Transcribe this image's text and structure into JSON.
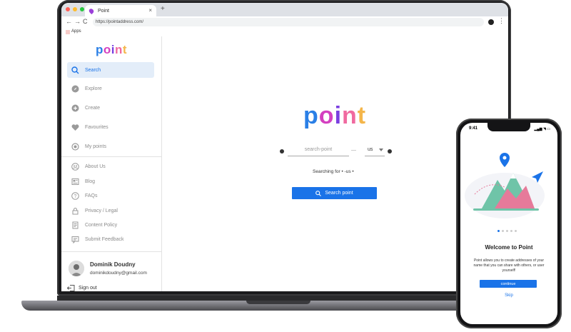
{
  "browser": {
    "tab_title": "Point",
    "tab_close": "×",
    "new_tab": "+",
    "back": "←",
    "forward": "→",
    "reload": "C",
    "url": "https://pointaddress.com/",
    "menu": "⋮",
    "bookmarks_label": "Apps",
    "window_dot_colors": [
      "#ff5f57",
      "#febc2e",
      "#28c840"
    ]
  },
  "brand": {
    "logo_letters": [
      "p",
      "o",
      "i",
      "n",
      "t"
    ]
  },
  "sidebar": {
    "items": [
      {
        "label": "Search",
        "icon": "search-icon"
      },
      {
        "label": "Explore",
        "icon": "compass-icon"
      },
      {
        "label": "Create",
        "icon": "plus-circle-icon"
      },
      {
        "label": "Favourites",
        "icon": "heart-icon"
      },
      {
        "label": "My points",
        "icon": "target-icon"
      }
    ],
    "secondary": [
      {
        "label": "About Us",
        "icon": "people-icon"
      },
      {
        "label": "Blog",
        "icon": "newspaper-icon"
      },
      {
        "label": "FAQs",
        "icon": "question-icon"
      },
      {
        "label": "Privacy / Legal",
        "icon": "lock-icon"
      },
      {
        "label": "Content Policy",
        "icon": "document-icon"
      },
      {
        "label": "Submit Feedback",
        "icon": "feedback-icon"
      }
    ],
    "user": {
      "name": "Dominik Doudny",
      "email": "dominikdoudny@gmail.com"
    },
    "signout_label": "Sign out"
  },
  "main": {
    "search_placeholder": "search-point",
    "dash": "—",
    "country_value": "us",
    "searching_text": "Searching for  •  -us  •",
    "search_button": "Search point",
    "accent_color": "#1a73e8"
  },
  "phone": {
    "time": "9:41",
    "status": "▂▄▆ ◥ ▭",
    "title": "Welcome to Point",
    "description": "Point allows you to create addresses of your name that you can share with others, or user yourself!",
    "button": "continue",
    "skip": "Skip"
  }
}
